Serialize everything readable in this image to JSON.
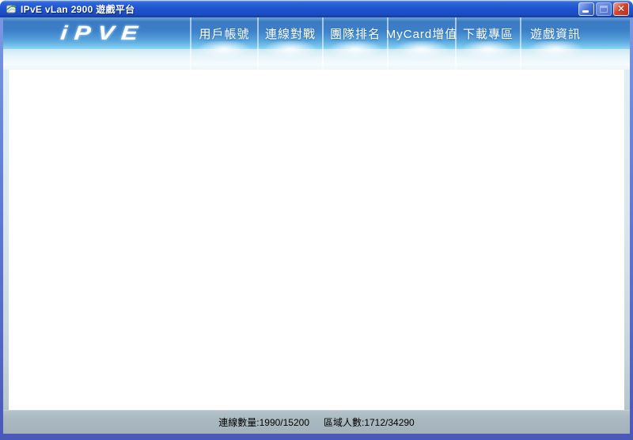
{
  "window": {
    "title": "IPvE vLan 2900 遊戲平台",
    "icons": {
      "app": "app-logo",
      "minimize": "_",
      "maximize": "□",
      "close": "✕"
    }
  },
  "brand": {
    "logo_text": "iPVE"
  },
  "nav": {
    "items": [
      {
        "label": "用戶帳號"
      },
      {
        "label": "連線對戰"
      },
      {
        "label": "團隊排名"
      },
      {
        "label": "MyCard增值"
      },
      {
        "label": "下載專區"
      },
      {
        "label": "遊戲資訊"
      }
    ]
  },
  "content": {
    "body_text": ""
  },
  "statusbar": {
    "connections": "連線數量:1990/15200",
    "regions": "區域人數:1712/34290"
  },
  "colors": {
    "titlebar_blue": "#1e54cf",
    "nav_blue": "#3b7ac2",
    "nav_light": "#92d8f5",
    "close_red": "#d8452f",
    "status_gray": "#aab8c0",
    "border_blue": "#5c74d2"
  }
}
